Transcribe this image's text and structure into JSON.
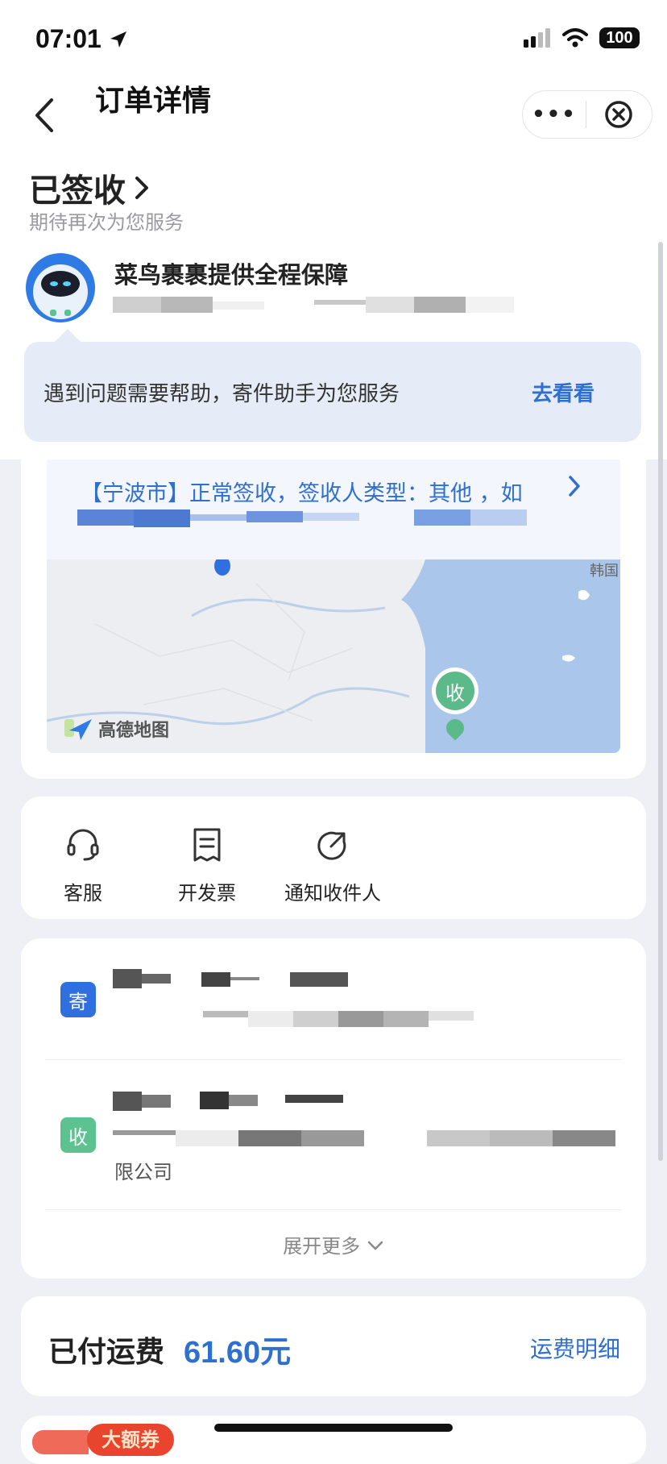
{
  "status_bar": {
    "time": "07:01",
    "battery": "100"
  },
  "header": {
    "title": "订单详情"
  },
  "order_status": {
    "title": "已签收",
    "subtitle": "期待再次为您服务"
  },
  "guarantee": {
    "title": "菜鸟裹裹提供全程保障"
  },
  "help": {
    "text": "遇到问题需要帮助，寄件助手为您服务",
    "action": "去看看"
  },
  "tracking": {
    "text": "【宁波市】正常签收，签收人类型：其他 ，如",
    "map_marker": "收",
    "map_logo": "高德地图"
  },
  "actions": [
    {
      "label": "客服",
      "icon": "headset-icon"
    },
    {
      "label": "开发票",
      "icon": "invoice-icon"
    },
    {
      "label": "通知收件人",
      "icon": "share-arrow-icon"
    }
  ],
  "address": {
    "sender_tag": "寄",
    "receiver_tag": "收",
    "receiver_tail": "限公司",
    "expand": "展开更多"
  },
  "fee": {
    "label": "已付运费",
    "amount": "61.60元",
    "detail": "运费明细"
  },
  "coupon": {
    "badge": "大额券"
  },
  "colors": {
    "accent": "#2f6fce",
    "sender_tag": "#2f6fe0",
    "receiver_tag": "#5cc28f",
    "coupon": "#e8442e"
  }
}
